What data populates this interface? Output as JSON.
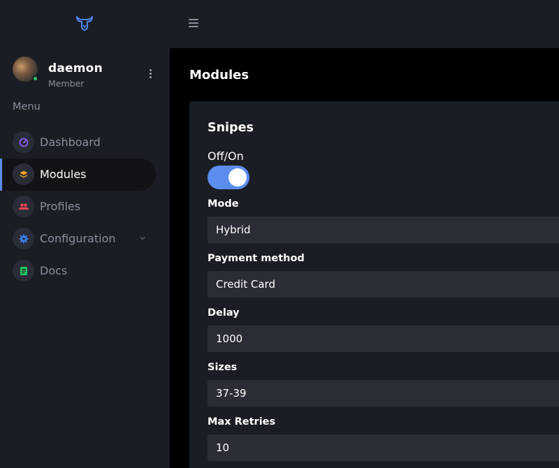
{
  "header": {
    "logo_icon": "bull-head-icon",
    "menu_icon": "hamburger-icon"
  },
  "user": {
    "name": "daemon",
    "role": "Member",
    "status_color": "#2ec76b"
  },
  "sidebar": {
    "menu_title": "Menu",
    "items": [
      {
        "label": "Dashboard",
        "icon": "speedometer-icon",
        "icon_color": "#8b5cf6",
        "active": false
      },
      {
        "label": "Modules",
        "icon": "layers-icon",
        "icon_color": "#f5a524",
        "active": true
      },
      {
        "label": "Profiles",
        "icon": "users-icon",
        "icon_color": "#e5484d",
        "active": false
      },
      {
        "label": "Configuration",
        "icon": "gear-icon",
        "icon_color": "#3b82f6",
        "active": false,
        "has_submenu": true
      },
      {
        "label": "Docs",
        "icon": "document-icon",
        "icon_color": "#22c55e",
        "active": false
      }
    ]
  },
  "main": {
    "title": "Modules",
    "card": {
      "title": "Snipes",
      "toggle_label": "Off/On",
      "toggle_on": true,
      "fields": [
        {
          "label": "Mode",
          "value": "Hybrid"
        },
        {
          "label": "Payment method",
          "value": "Credit Card"
        },
        {
          "label": "Delay",
          "value": "1000"
        },
        {
          "label": "Sizes",
          "value": "37-39"
        },
        {
          "label": "Max Retries",
          "value": "10"
        }
      ]
    }
  },
  "colors": {
    "accent": "#5b8def",
    "bg": "#1b1d24",
    "main_bg": "#000000",
    "input_bg": "#2a2d35",
    "muted_text": "#8a8f9f"
  }
}
